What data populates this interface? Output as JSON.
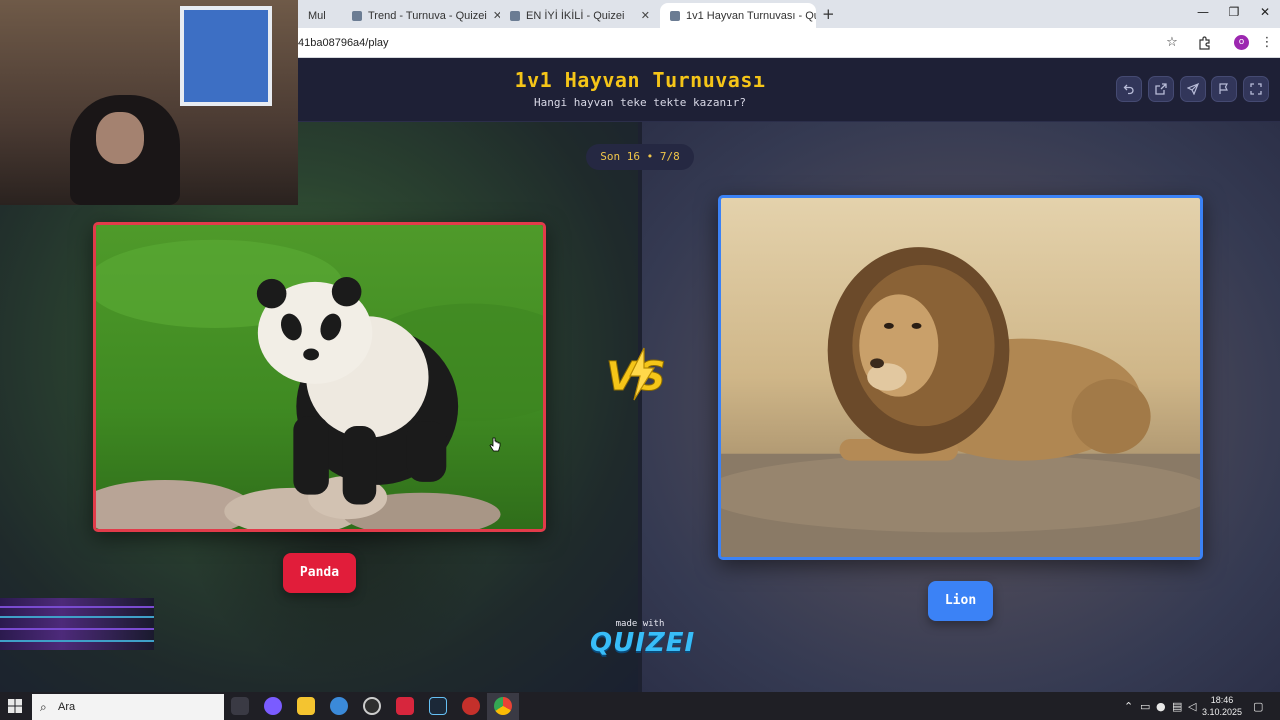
{
  "browser": {
    "tabs": [
      {
        "label": "Mul",
        "favicon_color": "#6b7c93"
      },
      {
        "label": "Trend - Turnuva - Quizei",
        "favicon_color": "#6b7c93"
      },
      {
        "label": "EN İYİ İKİLİ - Quizei",
        "favicon_color": "#6b7c93"
      },
      {
        "label": "1v1 Hayvan Turnuvası - Quizei",
        "favicon_color": "#6b7c93"
      }
    ],
    "active_tab_index": 3,
    "close_glyph": "✕",
    "new_tab_glyph": "+",
    "url": "41ba08796a4/play",
    "window_controls": {
      "minimize": "—",
      "restore": "❐",
      "close": "✕"
    },
    "profile_initial": "o"
  },
  "quiz": {
    "title": "1v1 Hayvan Turnuvası",
    "subtitle": "Hangi hayvan teke tekte kazanır?",
    "round_label": "Son 16 • 7/8",
    "header_buttons": [
      "undo-icon",
      "share-icon",
      "send-icon",
      "flag-icon",
      "fullscreen-icon"
    ]
  },
  "matchup": {
    "left": {
      "name": "Panda",
      "accent": "#e11d3a"
    },
    "right": {
      "name": "Lion",
      "accent": "#3b82f6"
    },
    "vs_text": "VS"
  },
  "branding": {
    "made_with": "made with",
    "brand_name": "QUIZEI"
  },
  "taskbar": {
    "search_placeholder": "Ara",
    "time": "18:46",
    "date": "3.10.2025",
    "pinned_apps": [
      {
        "name": "task-view-icon",
        "color": "#3a3a44"
      },
      {
        "name": "copilot-icon",
        "color": "#7a5cff"
      },
      {
        "name": "file-explorer-icon",
        "color": "#f4c430"
      },
      {
        "name": "browser-app-icon",
        "color": "#3b8ad9"
      },
      {
        "name": "recorder-app-icon",
        "color": "#2f2f2f"
      },
      {
        "name": "red-app-icon",
        "color": "#d7263d"
      },
      {
        "name": "steam-icon",
        "color": "#1b2838"
      },
      {
        "name": "media-player-icon",
        "color": "#c4302b"
      },
      {
        "name": "chrome-icon",
        "color": "#34a853"
      }
    ]
  }
}
